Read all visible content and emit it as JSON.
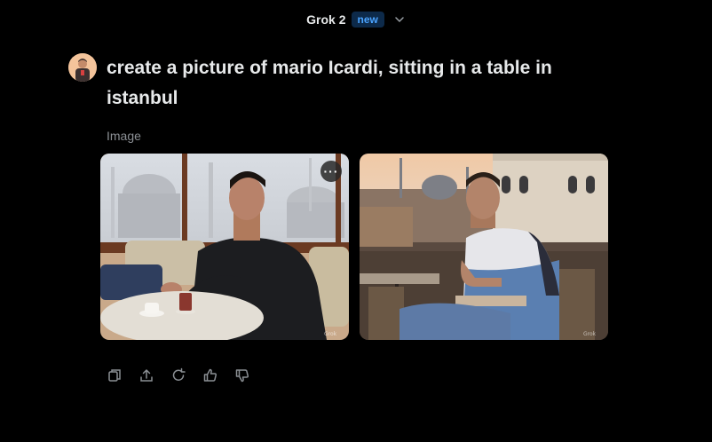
{
  "header": {
    "model_name": "Grok 2",
    "badge": "new",
    "dropdown_icon": "chevron-down-icon"
  },
  "message": {
    "avatar_icon": "user-avatar",
    "text": "create a picture of mario Icardi, sitting in a table in istanbul"
  },
  "result": {
    "label": "Image",
    "images": [
      {
        "name": "generated-image-1",
        "more_icon": "more-options-icon",
        "more_label": "···"
      },
      {
        "name": "generated-image-2"
      }
    ]
  },
  "actions": [
    {
      "icon": "copy-icon"
    },
    {
      "icon": "share-icon"
    },
    {
      "icon": "regenerate-icon"
    },
    {
      "icon": "thumbs-up-icon"
    },
    {
      "icon": "thumbs-down-icon"
    }
  ],
  "colors": {
    "background": "#000000",
    "text": "#e7e9ea",
    "muted": "#8b8f94",
    "badge_text": "#4aa3ff",
    "badge_bg": "#0d2a4a"
  }
}
